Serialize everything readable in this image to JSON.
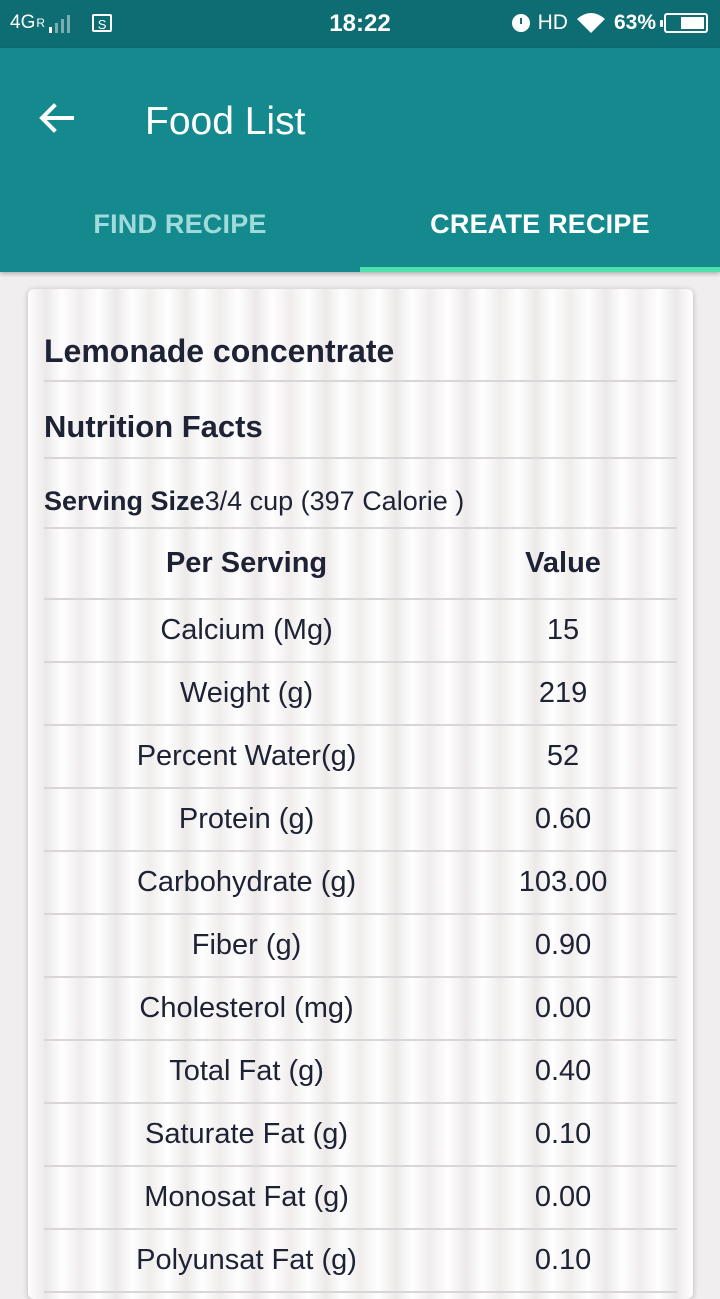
{
  "status_bar": {
    "network": "4G",
    "roaming": "R",
    "sim_label": "S",
    "time": "18:22",
    "hd": "HD",
    "battery": "63%",
    "battery_level": 0.63
  },
  "app_bar": {
    "title": "Food List",
    "tabs": [
      {
        "label": "FIND RECIPE",
        "active": false
      },
      {
        "label": "CREATE RECIPE",
        "active": true
      }
    ]
  },
  "card": {
    "food_name": "Lemonade concentrate",
    "facts_title": "Nutrition Facts",
    "serving_label": "Serving Size",
    "serving_value": "3/4 cup (397 Calorie )",
    "headers": [
      "Per Serving",
      "Value"
    ],
    "rows": [
      {
        "name": "Calcium (Mg)",
        "value": "15"
      },
      {
        "name": "Weight (g)",
        "value": "219"
      },
      {
        "name": "Percent Water(g)",
        "value": "52"
      },
      {
        "name": "Protein (g)",
        "value": "0.60"
      },
      {
        "name": "Carbohydrate (g)",
        "value": "103.00"
      },
      {
        "name": "Fiber (g)",
        "value": "0.90"
      },
      {
        "name": "Cholesterol (mg)",
        "value": "0.00"
      },
      {
        "name": "Total Fat (g)",
        "value": "0.40"
      },
      {
        "name": "Saturate Fat (g)",
        "value": "0.10"
      },
      {
        "name": "Monosat Fat (g)",
        "value": "0.00"
      },
      {
        "name": "Polyunsat Fat (g)",
        "value": "0.10"
      }
    ]
  },
  "colors": {
    "status_bar": "#0d6d73",
    "app_bar": "#148a8f",
    "tab_indicator": "#4fe0b0",
    "text": "#1e2235"
  }
}
